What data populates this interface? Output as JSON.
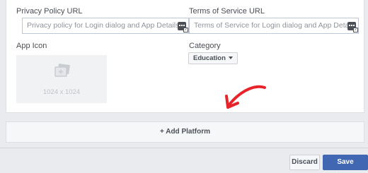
{
  "basic_settings": {
    "privacy_policy_label": "Privacy Policy URL",
    "privacy_policy_placeholder": "Privacy policy for Login dialog and App Details",
    "terms_label": "Terms of Service URL",
    "terms_placeholder": "Terms of Service for Login dialog and App Details",
    "app_icon_label": "App Icon",
    "app_icon_size": "1024 x 1024",
    "category_label": "Category",
    "category_value": "Education"
  },
  "add_platform": {
    "label": "+ Add Platform"
  },
  "footer": {
    "discard_label": "Discard",
    "save_label": "Save Changes"
  },
  "colors": {
    "primary_button": "#4267b2",
    "annotation_arrow": "#e8232a"
  },
  "icons": [
    "keyboard-input-icon",
    "photo-placeholder-icon",
    "chevron-down-icon",
    "annotation-arrow"
  ]
}
